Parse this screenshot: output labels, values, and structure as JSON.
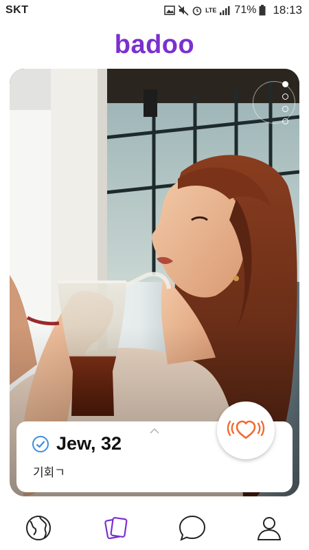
{
  "status_bar": {
    "carrier": "SKT",
    "battery": "71%",
    "time": "18:13",
    "network_label": "LTE"
  },
  "header": {
    "logo": "badoo"
  },
  "profile": {
    "name_age": "Jew, 32",
    "status_text": "기회ㄱ",
    "verified": true,
    "photo_count": 4,
    "active_photo": 0
  },
  "actions": {
    "like_icon": "heart-waves-icon"
  },
  "nav": {
    "items": [
      {
        "icon": "globe-icon",
        "active": false
      },
      {
        "icon": "cards-icon",
        "active": true
      },
      {
        "icon": "chat-bubble-icon",
        "active": false
      },
      {
        "icon": "person-icon",
        "active": false
      }
    ]
  },
  "colors": {
    "brand": "#7b2fd0",
    "like": "#f26a2e",
    "verified": "#3c8de0"
  }
}
